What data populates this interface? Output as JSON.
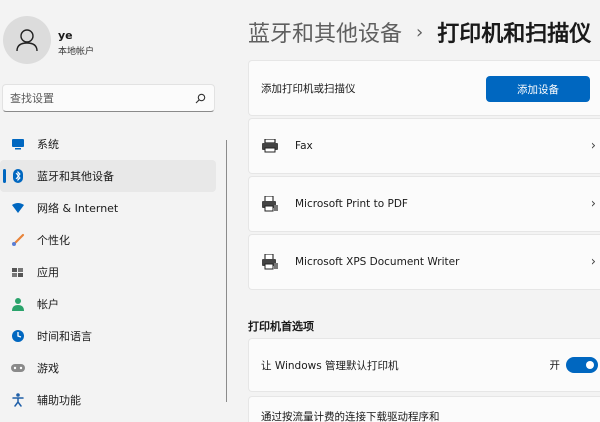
{
  "user": {
    "name": "ye",
    "account_type": "本地帐户"
  },
  "search": {
    "placeholder": "查找设置"
  },
  "nav": {
    "items": [
      {
        "label": "系统",
        "icon": "monitor-icon",
        "color": "#0067c0"
      },
      {
        "label": "蓝牙和其他设备",
        "icon": "bluetooth-icon",
        "color": "#0067c0",
        "active": true
      },
      {
        "label": "网络 & Internet",
        "icon": "wifi-icon",
        "color": "#0067c0"
      },
      {
        "label": "个性化",
        "icon": "paintbrush-icon",
        "color": "#e8843a"
      },
      {
        "label": "应用",
        "icon": "apps-icon",
        "color": "#555555"
      },
      {
        "label": "帐户",
        "icon": "person-icon",
        "color": "#2aa36b"
      },
      {
        "label": "时间和语言",
        "icon": "globe-clock-icon",
        "color": "#0067c0"
      },
      {
        "label": "游戏",
        "icon": "gamepad-icon",
        "color": "#7a7a7a"
      },
      {
        "label": "辅助功能",
        "icon": "accessibility-icon",
        "color": "#1f5fa8"
      }
    ]
  },
  "breadcrumb": {
    "parent": "蓝牙和其他设备",
    "separator": "›",
    "current": "打印机和扫描仪"
  },
  "add_card": {
    "label": "添加打印机或扫描仪",
    "button": "添加设备"
  },
  "printers": [
    {
      "name": "Fax",
      "icon": "fax-icon"
    },
    {
      "name": "Microsoft Print to PDF",
      "icon": "printer-icon"
    },
    {
      "name": "Microsoft XPS Document Writer",
      "icon": "printer-icon"
    }
  ],
  "preferences": {
    "heading": "打印机首选项",
    "default_printer": {
      "label": "让 Windows 管理默认打印机",
      "state": "开",
      "on": true
    },
    "metered": {
      "label": "通过按流量计费的连接下载驱动程序和"
    }
  },
  "colors": {
    "accent": "#0067c0",
    "background": "#f3f3f3",
    "card": "#fbfbfb"
  }
}
